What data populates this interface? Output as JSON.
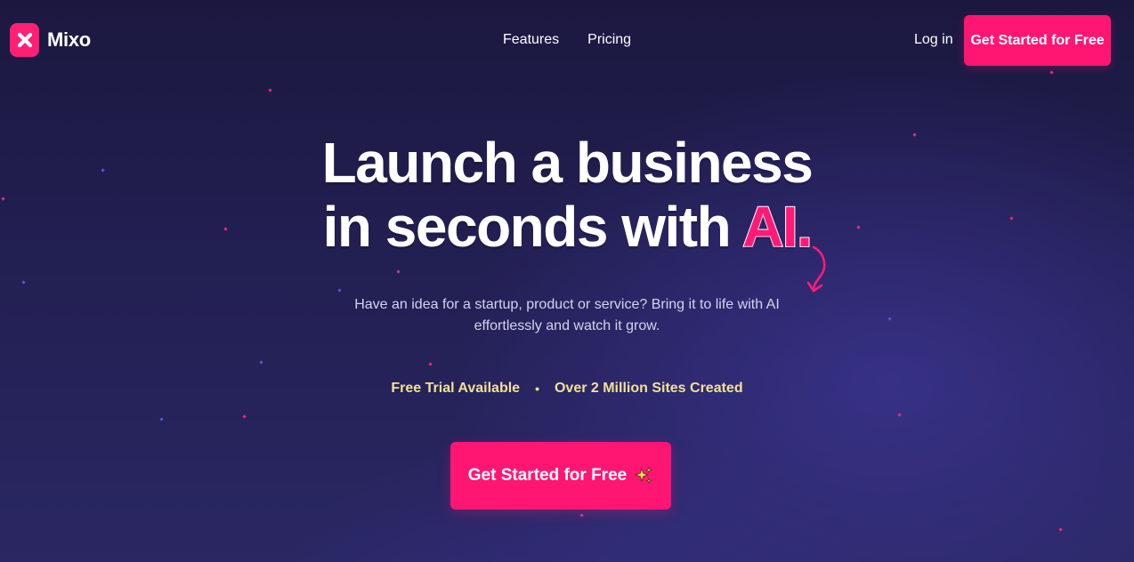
{
  "brand": {
    "name": "Mixo",
    "logo_icon": "x-mark-icon",
    "accent_color": "#ff1673"
  },
  "nav": {
    "items": [
      {
        "label": "Features"
      },
      {
        "label": "Pricing"
      }
    ],
    "login_label": "Log in",
    "cta_label": "Get Started for Free"
  },
  "hero": {
    "title_line1": "Launch a business",
    "title_line2_prefix": "in seconds with ",
    "title_accent": "AI.",
    "subtitle": "Have an idea for a startup, product or service? Bring it to life with AI effortlessly and watch it grow.",
    "badges": [
      "Free Trial Available",
      "Over 2 Million Sites Created"
    ],
    "badge_separator": "•",
    "cta_label": "Get Started for Free",
    "cta_icon": "sparkles-icon"
  },
  "colors": {
    "background_top": "#1b1840",
    "background_bottom": "#2a2763",
    "badge_text": "#f4e18f",
    "subtitle_text": "#d4d3ee"
  }
}
